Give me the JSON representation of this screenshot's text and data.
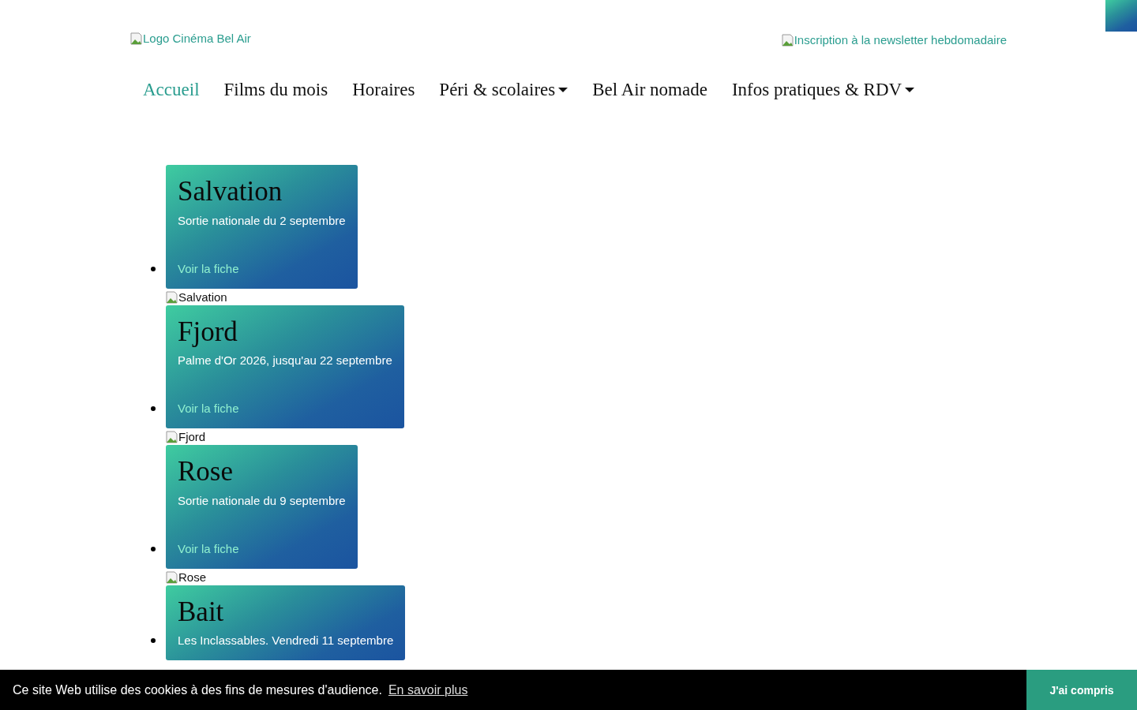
{
  "header": {
    "logo_alt": "Logo Cinéma Bel Air",
    "newsletter_alt": "Inscription à la newsletter hebdomadaire"
  },
  "nav": [
    {
      "label": "Accueil",
      "selected": true,
      "dropdown": false
    },
    {
      "label": "Films du mois",
      "selected": false,
      "dropdown": false
    },
    {
      "label": "Horaires",
      "selected": false,
      "dropdown": false
    },
    {
      "label": "Péri & scolaires",
      "selected": false,
      "dropdown": true
    },
    {
      "label": "Bel Air nomade",
      "selected": false,
      "dropdown": false
    },
    {
      "label": "Infos pratiques & RDV",
      "selected": false,
      "dropdown": true
    }
  ],
  "films": [
    {
      "title": "Salvation",
      "subtitle": "Sortie nationale du 2 septembre",
      "link": "Voir la fiche",
      "image_alt": "Salvation"
    },
    {
      "title": "Fjord",
      "subtitle": "Palme d'Or 2026, jusqu'au 22 septembre",
      "link": "Voir la fiche",
      "image_alt": "Fjord"
    },
    {
      "title": "Rose",
      "subtitle": "Sortie nationale du 9 septembre",
      "link": "Voir la fiche",
      "image_alt": "Rose"
    },
    {
      "title": "Bait",
      "subtitle": "Les Inclassables. Vendredi 11 septembre"
    }
  ],
  "cookie_bar": {
    "message": "Ce site Web utilise des cookies à des fins de mesures d'audience.",
    "link": "En savoir plus",
    "button": "J'ai compris"
  }
}
